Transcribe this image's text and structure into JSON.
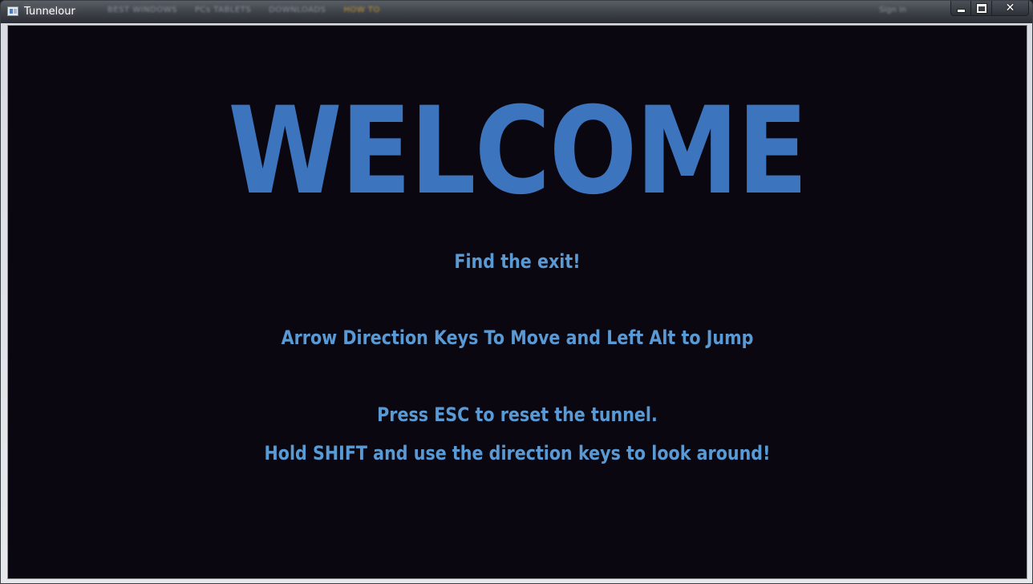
{
  "window": {
    "title": "Tunnelour",
    "background_menu": [
      "BEST WINDOWS",
      "PCs TABLETS",
      "DOWNLOADS",
      "HOW TO"
    ],
    "background_signin": "Sign in",
    "controls": {
      "minimize_icon": "minimize-icon",
      "maximize_icon": "maximize-icon",
      "close_icon": "close-icon",
      "close_glyph": "✕"
    }
  },
  "game": {
    "heading": "WELCOME",
    "messages": [
      "Find the exit!",
      "Arrow Direction Keys To Move and Left Alt to Jump",
      "Press ESC to reset the tunnel.",
      "Hold SHIFT and use the direction keys to look around!"
    ]
  },
  "colors": {
    "background": "#0a0710",
    "heading": "#3d74be",
    "text": "#5a9ad4"
  }
}
